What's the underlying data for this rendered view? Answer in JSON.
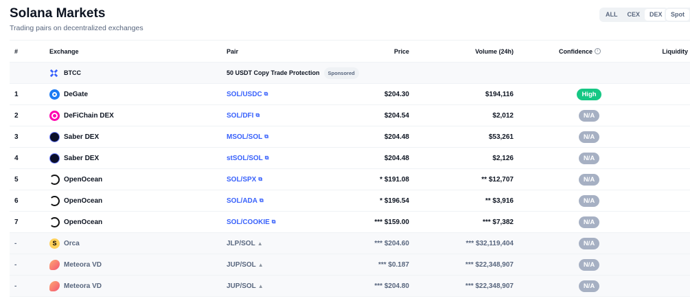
{
  "header": {
    "title": "Solana Markets",
    "subtitle": "Trading pairs on decentralized exchanges"
  },
  "filters": {
    "type": [
      "ALL",
      "CEX",
      "DEX"
    ],
    "selected": "DEX",
    "category": "Spot"
  },
  "columns": {
    "num": "#",
    "exchange": "Exchange",
    "pair": "Pair",
    "price": "Price",
    "volume": "Volume (24h)",
    "confidence": "Confidence",
    "liquidity": "Liquidity"
  },
  "sponsored": {
    "exchange": "BTCC",
    "text": "50 USDT Copy Trade Protection",
    "badge": "Sponsored"
  },
  "colors": {
    "high": "#16c784",
    "na": "#a6b0c3",
    "link": "#3861fb"
  },
  "rows": [
    {
      "num": "1",
      "exchange": "DeGate",
      "icon": "degate",
      "pair": "SOL/USDC",
      "price": "$204.30",
      "volume": "$194,116",
      "confidence": "High",
      "muted": false
    },
    {
      "num": "2",
      "exchange": "DeFiChain DEX",
      "icon": "defichain",
      "pair": "SOL/DFI",
      "price": "$204.54",
      "volume": "$2,012",
      "confidence": "N/A",
      "muted": false
    },
    {
      "num": "3",
      "exchange": "Saber DEX",
      "icon": "saber",
      "pair": "MSOL/SOL",
      "price": "$204.48",
      "volume": "$53,261",
      "confidence": "N/A",
      "muted": false
    },
    {
      "num": "4",
      "exchange": "Saber DEX",
      "icon": "saber",
      "pair": "stSOL/SOL",
      "price": "$204.48",
      "volume": "$2,126",
      "confidence": "N/A",
      "muted": false
    },
    {
      "num": "5",
      "exchange": "OpenOcean",
      "icon": "openocean",
      "pair": "SOL/SPX",
      "price": "* $191.08",
      "volume": "** $12,707",
      "confidence": "N/A",
      "muted": false
    },
    {
      "num": "6",
      "exchange": "OpenOcean",
      "icon": "openocean",
      "pair": "SOL/ADA",
      "price": "* $196.54",
      "volume": "** $3,916",
      "confidence": "N/A",
      "muted": false
    },
    {
      "num": "7",
      "exchange": "OpenOcean",
      "icon": "openocean",
      "pair": "SOL/COOKIE",
      "price": "*** $159.00",
      "volume": "*** $7,382",
      "confidence": "N/A",
      "muted": false
    },
    {
      "num": "-",
      "exchange": "Orca",
      "icon": "orca",
      "pair": "JLP/SOL",
      "price": "*** $204.60",
      "volume": "*** $32,119,404",
      "confidence": "N/A",
      "muted": true
    },
    {
      "num": "-",
      "exchange": "Meteora VD",
      "icon": "meteora",
      "pair": "JUP/SOL",
      "price": "*** $0.187",
      "volume": "*** $22,348,907",
      "confidence": "N/A",
      "muted": true
    },
    {
      "num": "-",
      "exchange": "Meteora VD",
      "icon": "meteora",
      "pair": "JUP/SOL",
      "price": "*** $204.80",
      "volume": "*** $22,348,907",
      "confidence": "N/A",
      "muted": true
    }
  ]
}
